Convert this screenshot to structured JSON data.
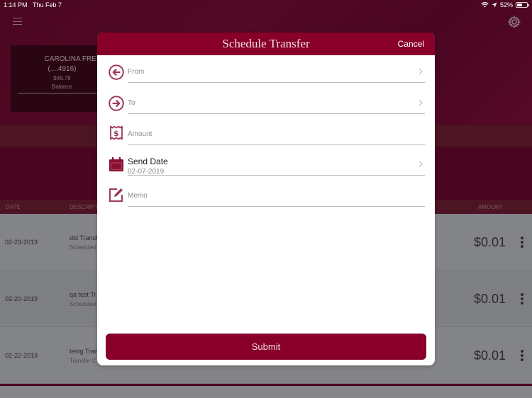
{
  "status_bar": {
    "time": "1:14 PM",
    "date": "Thu Feb 7",
    "battery_percent_label": "52%",
    "battery_level": 0.52,
    "icons": [
      "wifi-icon",
      "location-icon",
      "battery-icon"
    ]
  },
  "header": {
    "menu_icon": "hamburger-menu-icon",
    "settings_icon": "gear-icon"
  },
  "account_card": {
    "name": "CAROLINA FREE",
    "number": "(....4916)",
    "balance": "$49.78",
    "balance_label": "Balance"
  },
  "table": {
    "headers": {
      "date": "DATE",
      "description": "DESCRIPT",
      "amount": "AMOUNT"
    },
    "rows": [
      {
        "date": "02-23-2019",
        "title": "did Transf",
        "subtitle": "Scheduled",
        "amount": "$0.01"
      },
      {
        "date": "02-20-2019",
        "title": "qa test Tr",
        "subtitle": "Scheduled",
        "amount": "$0.01"
      },
      {
        "date": "02-22-2019",
        "title": "testg Tran",
        "subtitle": "Transfer C",
        "amount": "$0.01"
      }
    ]
  },
  "modal": {
    "title": "Schedule Transfer",
    "cancel_label": "Cancel",
    "fields": {
      "from": {
        "label": "From",
        "icon": "arrow-left-circle-icon",
        "has_chevron": true
      },
      "to": {
        "label": "To",
        "icon": "arrow-right-circle-icon",
        "has_chevron": true
      },
      "amount": {
        "label": "Amount",
        "icon": "receipt-dollar-icon",
        "has_chevron": false
      },
      "send_date": {
        "label": "Send Date",
        "value": "02-07-2019",
        "icon": "calendar-icon",
        "has_chevron": true
      },
      "memo": {
        "label": "Memo",
        "icon": "edit-note-icon",
        "has_chevron": false
      }
    },
    "submit_label": "Submit"
  },
  "colors": {
    "brand": "#88002a",
    "background": "#4a0520",
    "icon": "#a0405a"
  }
}
